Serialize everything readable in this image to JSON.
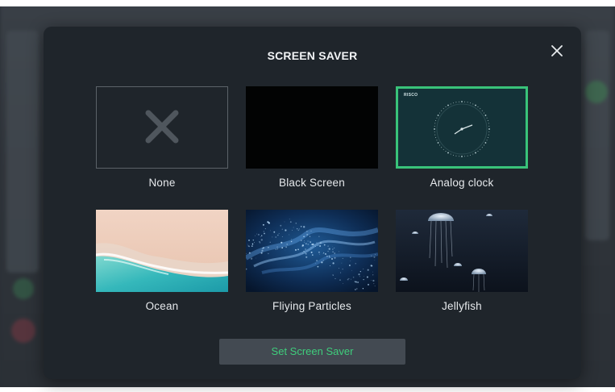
{
  "modal": {
    "title": "SCREEN SAVER",
    "close_icon": "close-icon",
    "options": [
      {
        "label": "None",
        "icon": "x-icon",
        "selected": false
      },
      {
        "label": "Black Screen",
        "selected": false
      },
      {
        "label": "Analog clock",
        "brand": "RISCO",
        "selected": true
      },
      {
        "label": "Ocean",
        "selected": false
      },
      {
        "label": "Fliying Particles",
        "selected": false
      },
      {
        "label": "Jellyfish",
        "selected": false
      }
    ],
    "set_button_label": "Set Screen Saver"
  },
  "colors": {
    "modal_bg": "#1f252b",
    "selected_border": "#39c37a",
    "button_text": "#3fcd7c",
    "button_bg": "#434a52"
  }
}
